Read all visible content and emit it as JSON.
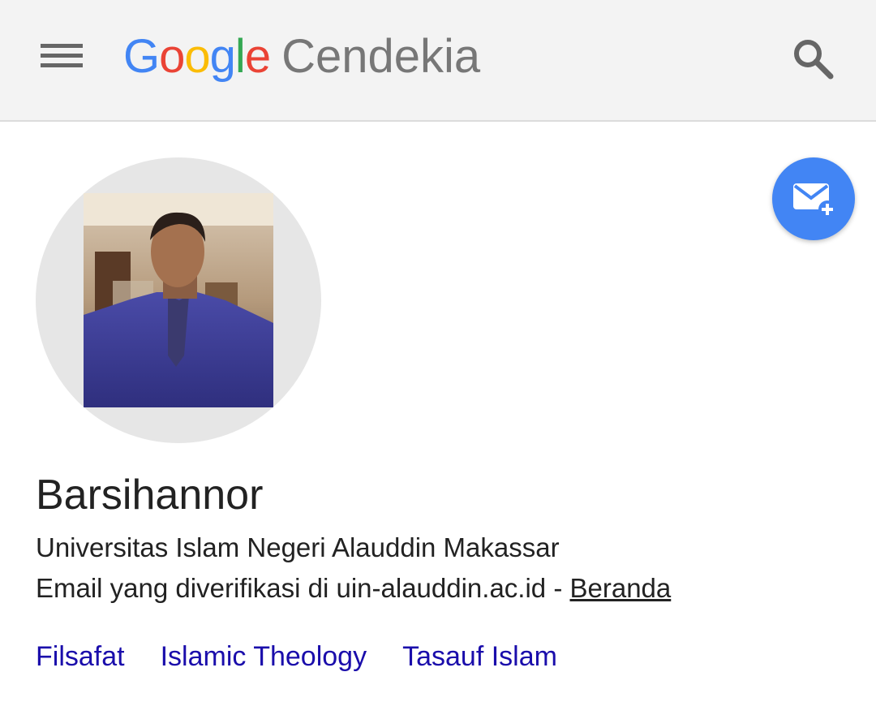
{
  "header": {
    "brand_letters": [
      {
        "ch": "G",
        "color": "#4285f4"
      },
      {
        "ch": "o",
        "color": "#ea4335"
      },
      {
        "ch": "o",
        "color": "#fbbc05"
      },
      {
        "ch": "g",
        "color": "#4285f4"
      },
      {
        "ch": "l",
        "color": "#34a853"
      },
      {
        "ch": "e",
        "color": "#ea4335"
      }
    ],
    "product": "Cendekia",
    "menu_icon": "hamburger-menu-icon",
    "search_icon": "search-icon"
  },
  "profile": {
    "name": "Barsihannor",
    "affiliation": "Universitas Islam Negeri Alauddin Makassar",
    "email_text": "Email yang diverifikasi di uin-alauddin.ac.id - ",
    "homepage_label": "Beranda",
    "follow_icon": "email-add-icon",
    "follow_color": "#4285f4",
    "interests": [
      "Filsafat",
      "Islamic Theology",
      "Tasauf Islam"
    ],
    "interest_color": "#1a0dab"
  }
}
